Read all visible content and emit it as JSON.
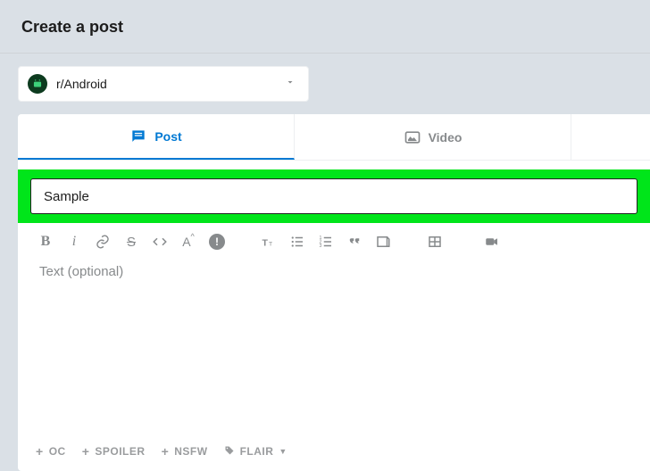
{
  "page": {
    "title": "Create a post"
  },
  "community": {
    "name": "r/Android",
    "icon": "android-icon"
  },
  "tabs": {
    "post": "Post",
    "video": "Video",
    "active": "post"
  },
  "form": {
    "title_value": "Sample",
    "body_placeholder": "Text (optional)"
  },
  "toolbar": {
    "bold": "B",
    "italic": "i",
    "link": "link",
    "strike": "S",
    "code": "</>",
    "super": "A",
    "spoiler": "!",
    "heading": "T",
    "ul": "ul",
    "ol": "ol",
    "quote": "quote",
    "codeblock": "codeblock",
    "table": "table",
    "video": "video"
  },
  "tags": {
    "oc": "OC",
    "spoiler": "SPOILER",
    "nsfw": "NSFW",
    "flair": "FLAIR"
  }
}
